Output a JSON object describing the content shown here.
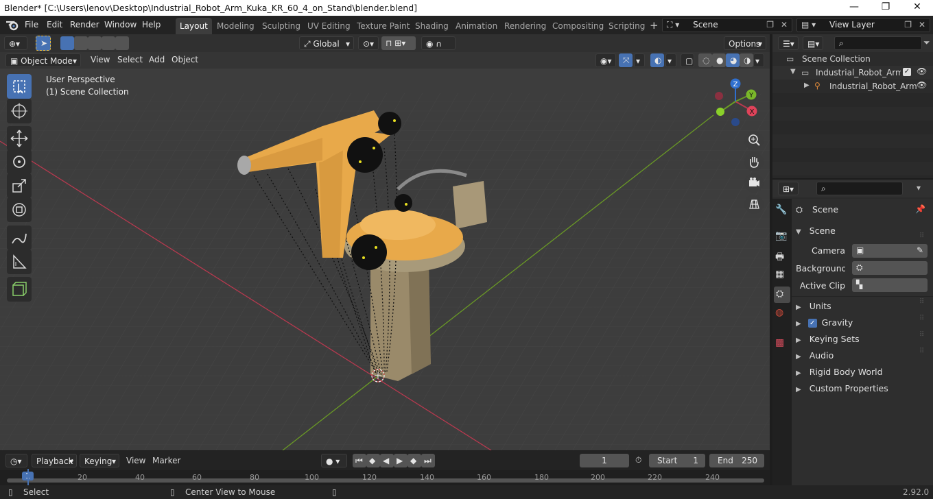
{
  "window": {
    "title": "Blender* [C:\\Users\\lenov\\Desktop\\Industrial_Robot_Arm_Kuka_KR_60_4_on_Stand\\blender.blend]",
    "minimize": "—",
    "maximize": "❐",
    "close": "✕"
  },
  "menubar": {
    "items": [
      "File",
      "Edit",
      "Render",
      "Window",
      "Help"
    ]
  },
  "workspaces": {
    "tabs": [
      "Layout",
      "Modeling",
      "Sculpting",
      "UV Editing",
      "Texture Paint",
      "Shading",
      "Animation",
      "Rendering",
      "Compositing",
      "Scripting"
    ],
    "active": "Layout",
    "add": "+"
  },
  "scene_selector": {
    "value": "Scene"
  },
  "viewlayer_selector": {
    "value": "View Layer"
  },
  "viewport_header": {
    "transform_orientation": "Global",
    "options": "Options"
  },
  "viewport_header2": {
    "mode": "Object Mode",
    "menus": [
      "View",
      "Select",
      "Add",
      "Object"
    ]
  },
  "viewport": {
    "perspective": "User Perspective",
    "collection": "(1) Scene Collection",
    "gizmo": {
      "x": "X",
      "y": "Y",
      "z": "Z"
    }
  },
  "outliner": {
    "items": [
      {
        "label": "Scene Collection"
      },
      {
        "label": "Industrial_Robot_Arm_Ku"
      },
      {
        "label": "Industrial_Robot_Arm"
      }
    ]
  },
  "properties": {
    "header": "Scene",
    "panel": "Scene",
    "fields": [
      {
        "label": "Camera"
      },
      {
        "label": "Background ..."
      },
      {
        "label": "Active Clip"
      }
    ],
    "sections": [
      {
        "label": "Units",
        "checked": null
      },
      {
        "label": "Gravity",
        "checked": true
      },
      {
        "label": "Keying Sets",
        "checked": null
      },
      {
        "label": "Audio",
        "checked": null
      },
      {
        "label": "Rigid Body World",
        "checked": null
      },
      {
        "label": "Custom Properties",
        "checked": null
      }
    ]
  },
  "timeline": {
    "menus": [
      "Playback",
      "Keying",
      "View",
      "Marker"
    ],
    "current_frame": "1",
    "start_label": "Start",
    "start": "1",
    "end_label": "End",
    "end": "250",
    "ticks": [
      "1",
      "20",
      "40",
      "60",
      "80",
      "100",
      "120",
      "140",
      "160",
      "180",
      "200",
      "220",
      "240"
    ]
  },
  "statusbar": {
    "left": "Select",
    "middle": "Center View to Mouse",
    "version": "2.92.0"
  },
  "colors": {
    "accent": "#4772b3",
    "robot": "#e8a94a",
    "stand": "#9a8a6a",
    "x_axis": "#b8394f",
    "y_axis": "#6a9a25",
    "z_axis": "#2f6fcf"
  }
}
